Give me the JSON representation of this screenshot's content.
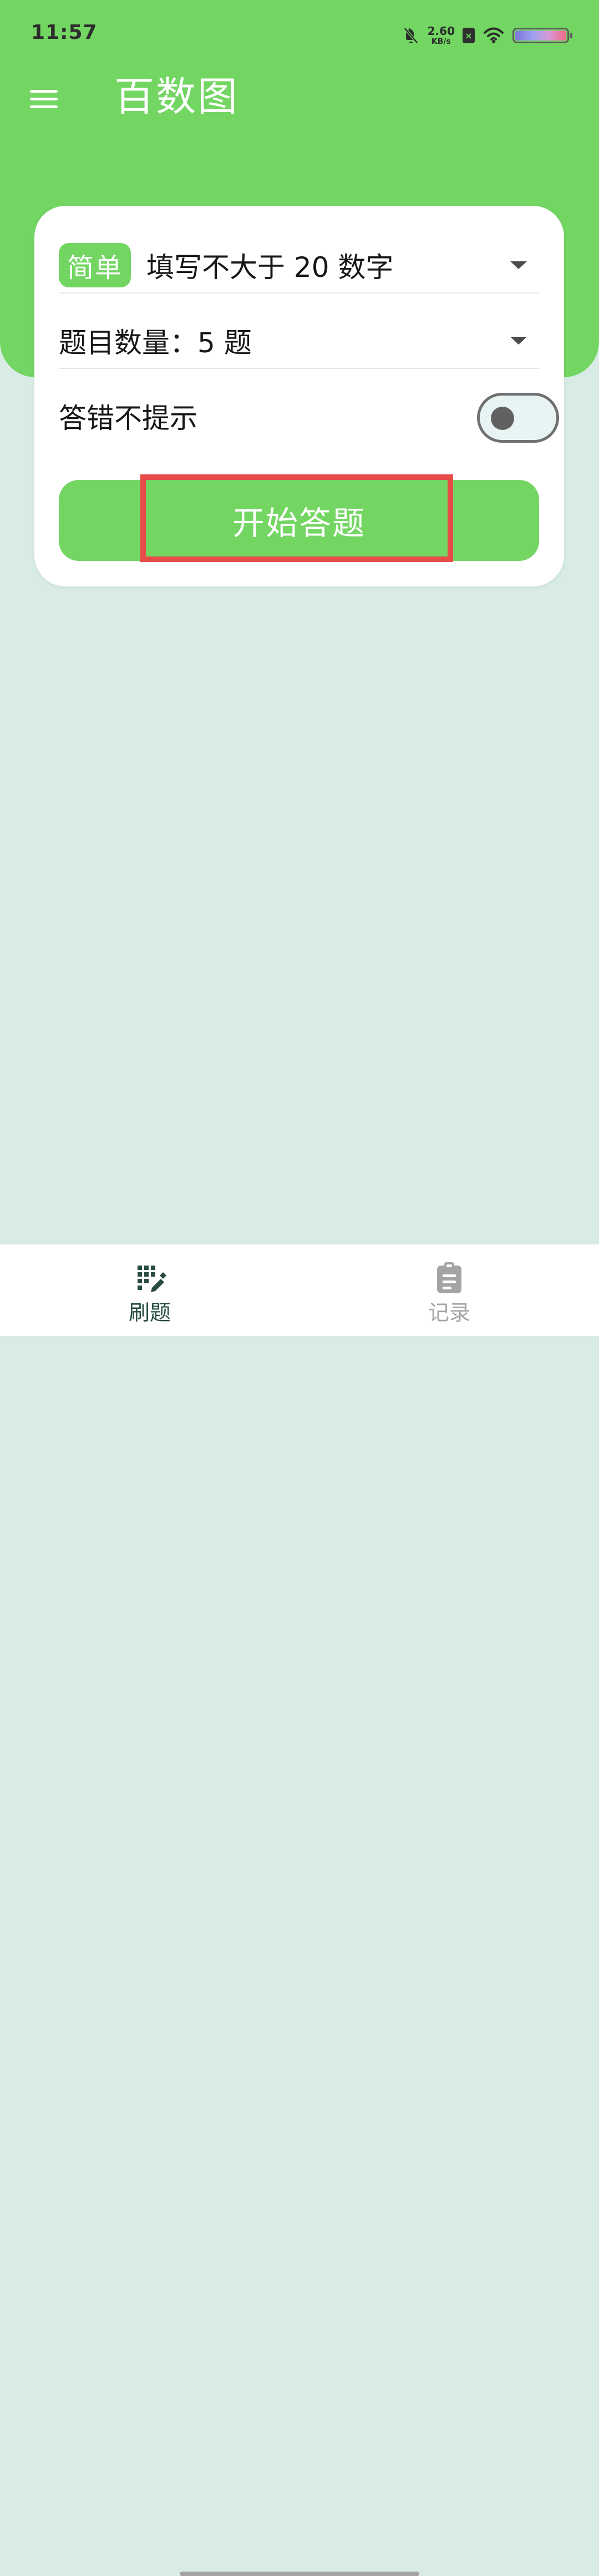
{
  "status_bar": {
    "time": "11:57",
    "network_speed_value": "2.60",
    "network_speed_unit": "KB/s",
    "sim_label": "×",
    "battery_colors": [
      "#7b76d9",
      "#9ea2ef",
      "#d69ad7",
      "#f06a88"
    ]
  },
  "header": {
    "title": "百数图",
    "menu_icon": "menu-icon",
    "background_color": "#73d663"
  },
  "settings": {
    "difficulty_badge": "简单",
    "difficulty_text": "填写不大于 20 数字",
    "question_count_text": "题目数量：5 题",
    "wrong_answer_hint_label": "答错不提示",
    "wrong_answer_hint_enabled": false,
    "start_button_label": "开始答题"
  },
  "bottom_nav": {
    "items": [
      {
        "label": "刷题",
        "icon": "grid-edit-icon",
        "active": true
      },
      {
        "label": "记录",
        "icon": "clipboard-icon",
        "active": false
      }
    ]
  },
  "colors": {
    "accent": "#73d663",
    "page_background": "#d8ece5",
    "highlight": "#e74c48",
    "active_nav": "#264c43",
    "inactive_nav": "#a4a4a4"
  }
}
